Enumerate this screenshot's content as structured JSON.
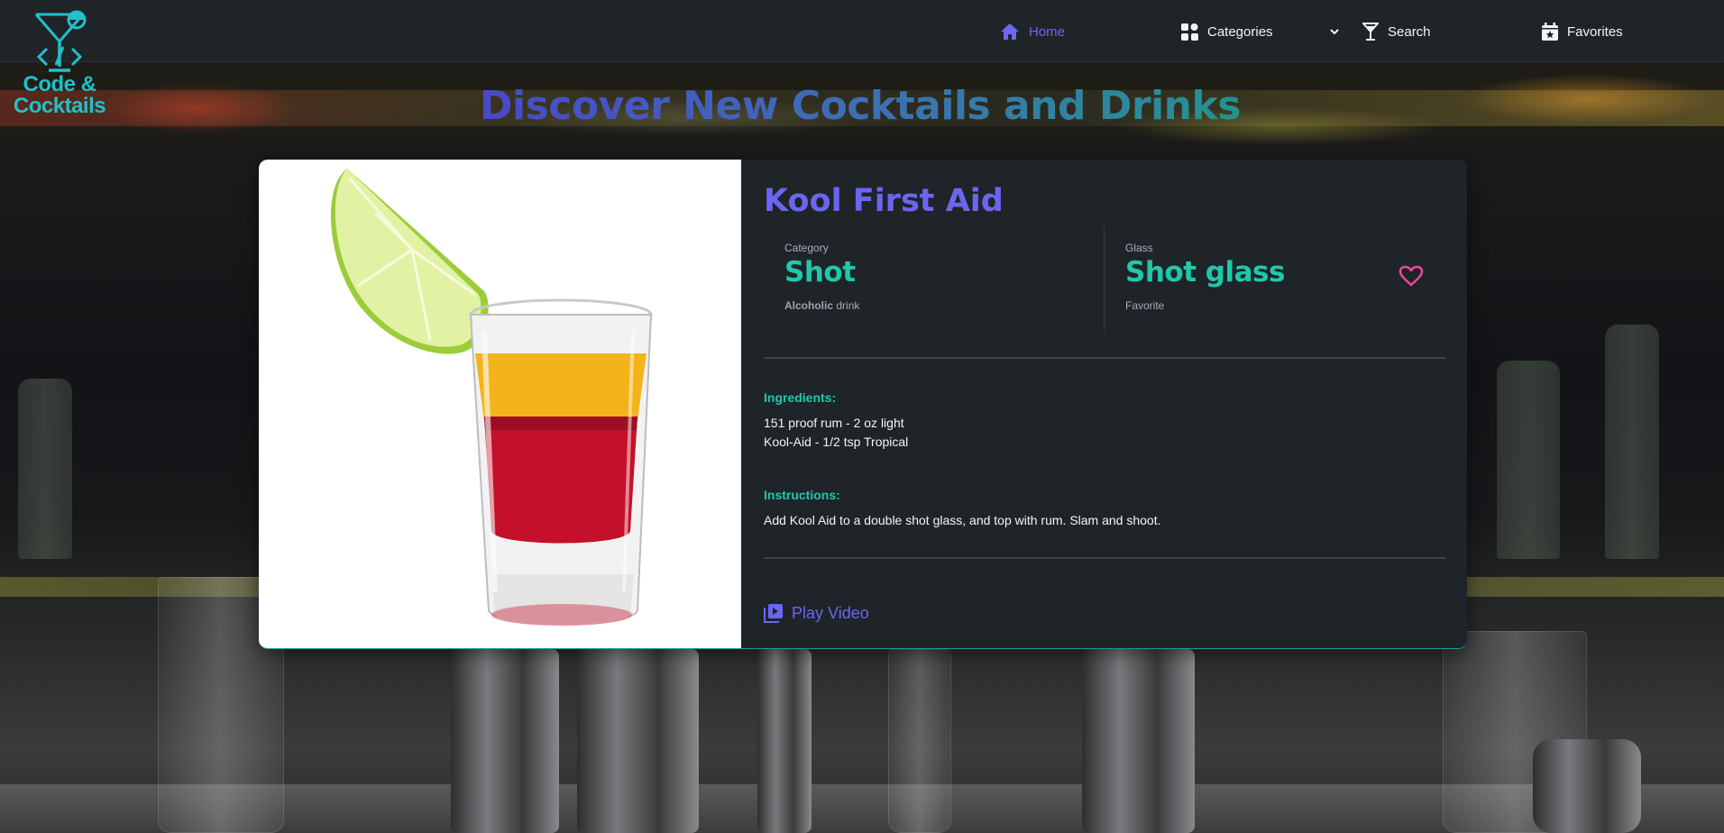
{
  "brand": {
    "name_line1": "Code &",
    "name_line2": "Cocktails"
  },
  "nav": {
    "home": "Home",
    "categories": "Categories",
    "search": "Search",
    "favorites": "Favorites"
  },
  "headline": "Discover New Cocktails and Drinks !",
  "drink": {
    "name": "Kool First Aid",
    "category_title": "Category",
    "category": "Shot",
    "alcoholic_strong": "Alcoholic",
    "alcoholic_rest": "drink",
    "glass_title": "Glass",
    "glass": "Shot glass",
    "favorite_label": "Favorite",
    "ingredients_title": "Ingredients:",
    "ingredients": [
      "151 proof rum - 2 oz light",
      "Kool-Aid - 1/2 tsp Tropical"
    ],
    "instructions_title": "Instructions:",
    "instructions": "Add Kool Aid to a double shot glass, and top with rum. Slam and shoot.",
    "play_video": "Play Video"
  },
  "colors": {
    "accent": "#6a66f0",
    "teal": "#1ec9a9",
    "logo": "#22c0c8",
    "heart": "#ec4899",
    "card": "#1f2429"
  },
  "icons": {
    "home": "home-icon",
    "categories": "grid-icon",
    "search": "cocktail-glass-icon",
    "favorites": "calendar-star-icon",
    "favorite": "heart-icon",
    "video": "video-library-icon"
  }
}
